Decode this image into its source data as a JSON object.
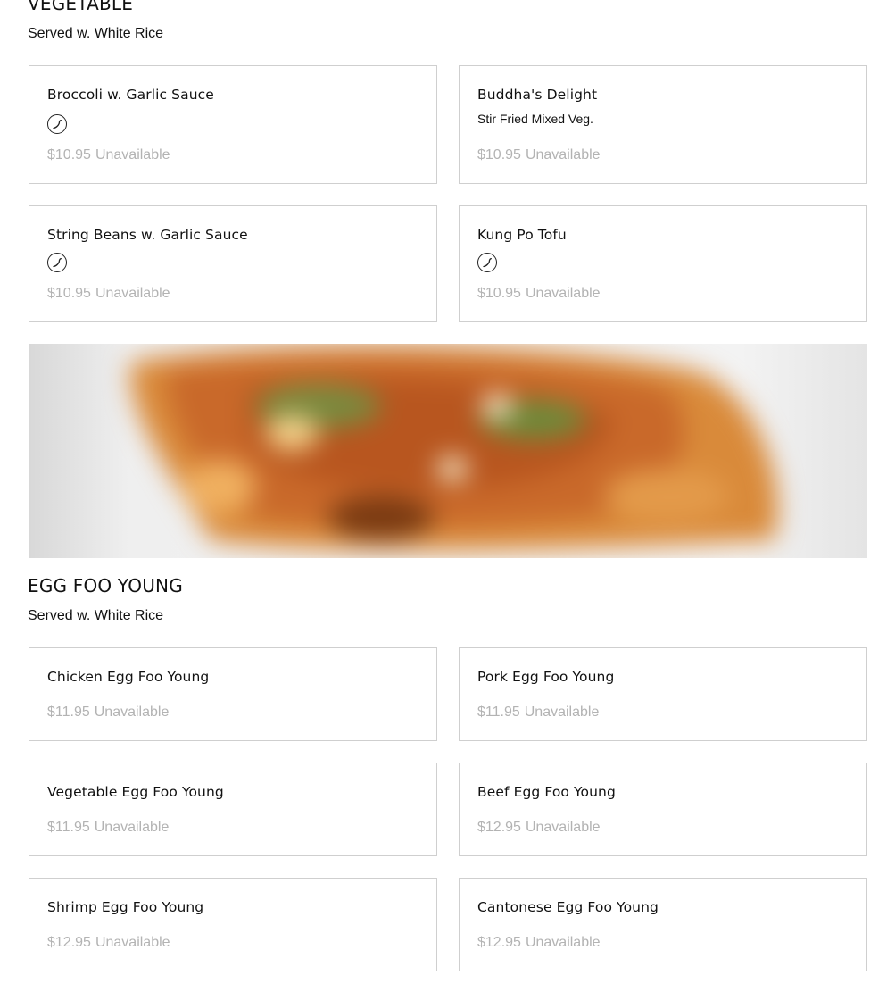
{
  "vegetable": {
    "title": "VEGETABLE",
    "subtitle": "Served w. White Rice",
    "items": [
      {
        "name": "Broccoli w. Garlic Sauce",
        "description": "",
        "spicy": true,
        "price": "$10.95",
        "status": "Unavailable"
      },
      {
        "name": "Buddha's Delight",
        "description": "Stir Fried Mixed Veg.",
        "spicy": false,
        "price": "$10.95",
        "status": "Unavailable"
      },
      {
        "name": "String Beans w. Garlic Sauce",
        "description": "",
        "spicy": true,
        "price": "$10.95",
        "status": "Unavailable"
      },
      {
        "name": "Kung Po Tofu",
        "description": "",
        "spicy": true,
        "price": "$10.95",
        "status": "Unavailable"
      }
    ]
  },
  "egg_foo_young": {
    "title": "EGG FOO YOUNG",
    "subtitle": "Served w. White Rice",
    "items": [
      {
        "name": "Chicken Egg Foo Young",
        "price": "$11.95",
        "status": "Unavailable"
      },
      {
        "name": "Pork Egg Foo Young",
        "price": "$11.95",
        "status": "Unavailable"
      },
      {
        "name": "Vegetable Egg Foo Young",
        "price": "$11.95",
        "status": "Unavailable"
      },
      {
        "name": "Beef Egg Foo Young",
        "price": "$12.95",
        "status": "Unavailable"
      },
      {
        "name": "Shrimp Egg Foo Young",
        "price": "$12.95",
        "status": "Unavailable"
      },
      {
        "name": "Cantonese Egg Foo Young",
        "price": "$12.95",
        "status": "Unavailable"
      }
    ]
  },
  "icons": {
    "spicy": "chili-pepper-icon"
  },
  "colors": {
    "unavailable_text": "#b3b3b3",
    "card_border": "#cfcfcf"
  }
}
